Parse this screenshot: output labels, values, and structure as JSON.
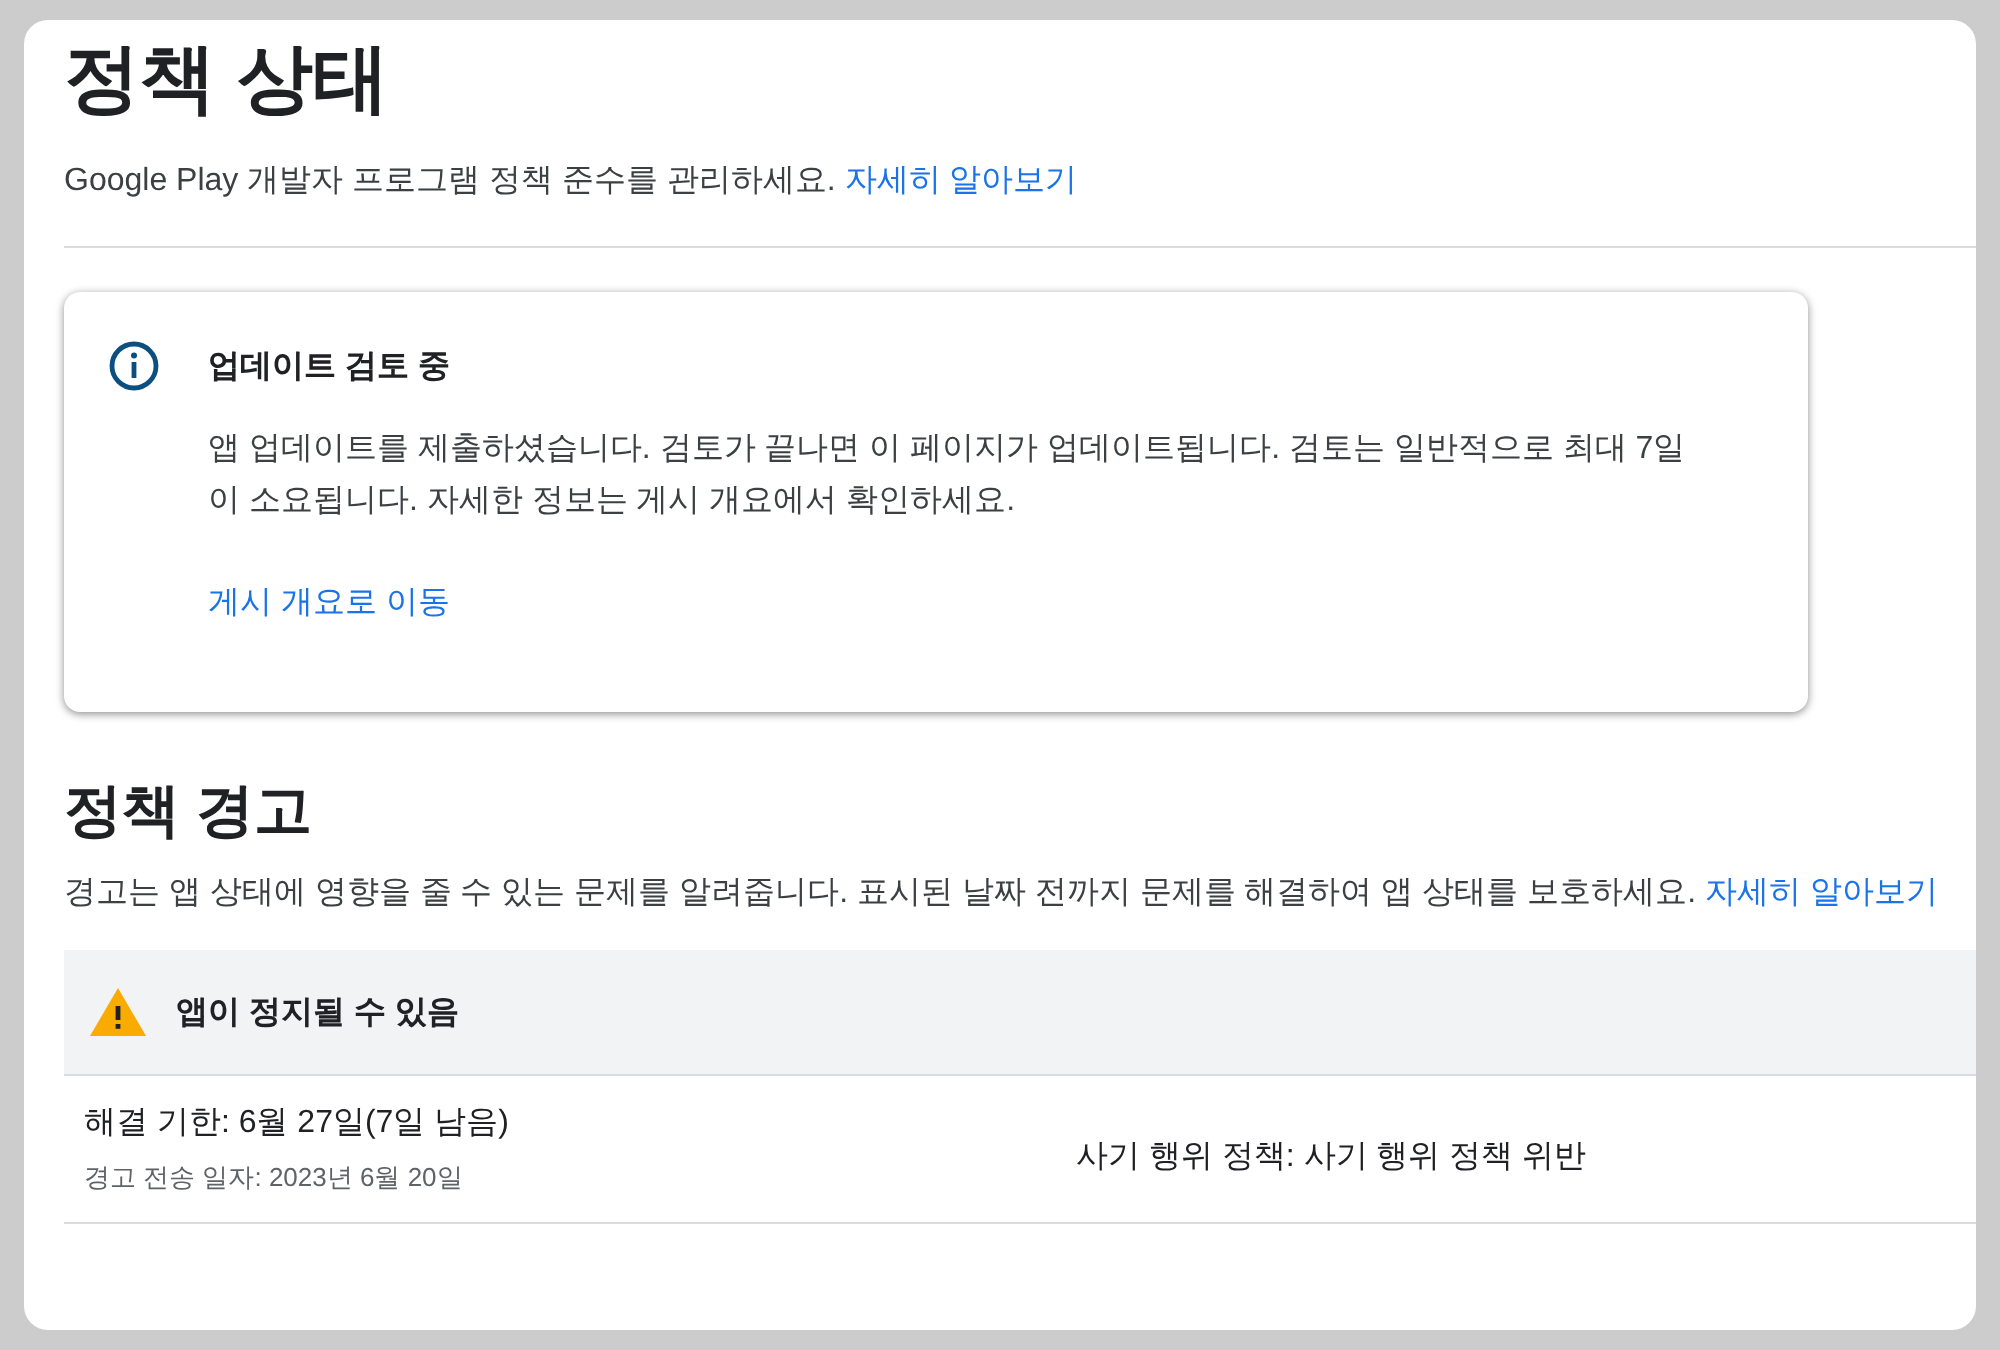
{
  "header": {
    "title": "정책 상태",
    "description": "Google Play 개발자 프로그램 정책 준수를 관리하세요.",
    "link": "자세히 알아보기"
  },
  "notice": {
    "kind": "info",
    "title": "업데이트 검토 중",
    "body": "앱 업데이트를 제출하셨습니다. 검토가 끝나면 이 페이지가 업데이트됩니다. 검토는 일반적으로 최대 7일이 소요됩니다. 자세한 정보는 게시 개요에서 확인하세요.",
    "action": "게시 개요로 이동"
  },
  "warnings": {
    "title": "정책 경고",
    "description": "경고는 앱 상태에 영향을 줄 수 있는 문제를 알려줍니다. 표시된 날짜 전까지 문제를 해결하여 앱 상태를 보호하세요.",
    "link": "자세히 알아보기",
    "groups": [
      {
        "kind": "warning",
        "title": "앱이 정지될 수 있음",
        "rows": [
          {
            "deadline": "해결 기한: 6월 27일(7일 남음)",
            "sent": "경고 전송 일자: 2023년 6월 20일",
            "policy": "사기 행위 정책: 사기 행위 정책 위반"
          }
        ]
      }
    ]
  }
}
